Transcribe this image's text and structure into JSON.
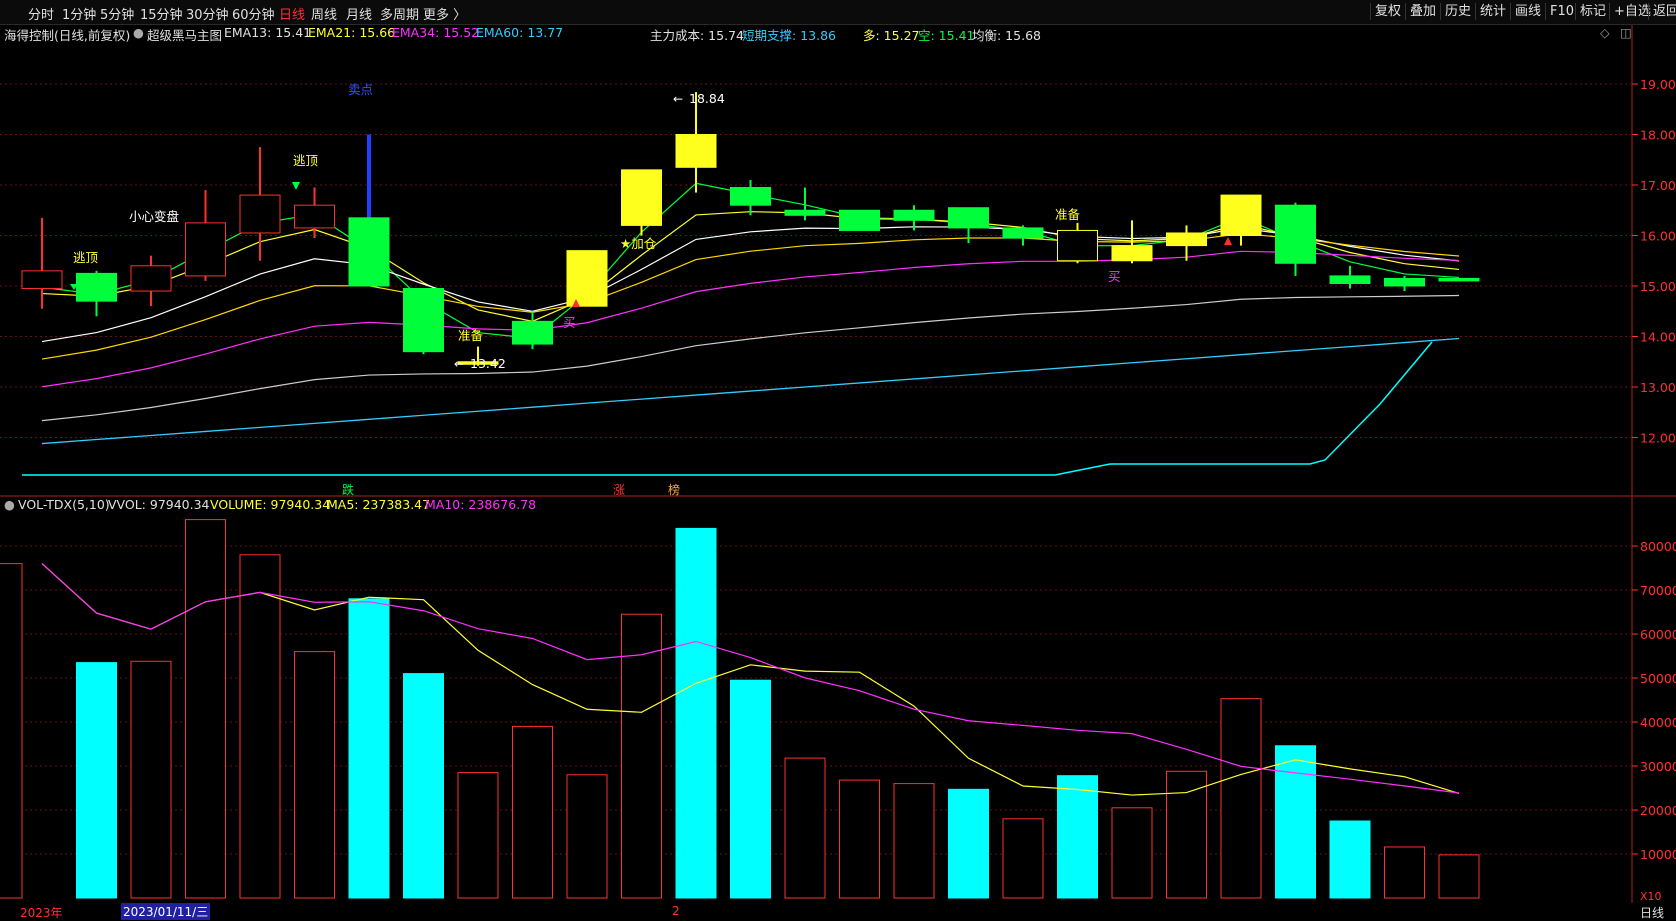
{
  "toolbar": {
    "timeframes": [
      "分时",
      "1分钟",
      "5分钟",
      "15分钟",
      "30分钟",
      "60分钟",
      "日线",
      "周线",
      "月线",
      "多周期",
      "更多 〉"
    ],
    "active_timeframe": "日线",
    "right_buttons": [
      "复权",
      "叠加",
      "历史",
      "统计",
      "画线",
      "F10",
      "标记",
      "+自选",
      "返回"
    ]
  },
  "main_header": {
    "stock": "海得控制(日线,前复权)",
    "indicator": "超级黑马主图",
    "ema13": "EMA13: 15.41",
    "ema21": "EMA21: 15.66",
    "ema34": "EMA34: 15.52",
    "ema60": "EMA60: 13.77",
    "cost": "主力成本: 15.74",
    "support": "短期支撑: 13.86",
    "long": "多: 15.27",
    "short": "空: 15.41",
    "balance": "均衡: 15.68"
  },
  "volume_header": {
    "name": "VOL-TDX(5,10)",
    "vvol": "VVOL: 97940.34",
    "volume": "VOLUME: 97940.34",
    "ma5": "MA5: 237383.47",
    "ma10": "MA10: 238676.78"
  },
  "price_axis": [
    "19.00",
    "18.00",
    "17.00",
    "16.00",
    "15.00",
    "14.00",
    "13.00",
    "12.00"
  ],
  "volume_axis": [
    "80000",
    "70000",
    "60000",
    "50000",
    "40000",
    "30000",
    "20000",
    "10000"
  ],
  "volume_unit": "X10",
  "annotations": {
    "high": "18.84",
    "low": "13.42",
    "sell_point": "卖点",
    "escape1": "逃顶",
    "escape2": "逃顶",
    "caution": "小心变盘",
    "prepare1": "准备",
    "prepare2": "准备",
    "add_position": "★加仓",
    "buy1": "买",
    "buy2": "买",
    "fall_tag": "跌",
    "rise_tag": "涨",
    "list_tag": "榜"
  },
  "bottom_bar": {
    "year": "2023年",
    "date": "2023/01/11/三",
    "marker": "2",
    "period": "日线"
  },
  "candles": [
    {
      "o": 15.3,
      "c": 14.95,
      "h": 16.35,
      "l": 14.55,
      "t": "hollow"
    },
    {
      "o": 15.25,
      "c": 14.7,
      "h": 15.3,
      "l": 14.4,
      "t": "green"
    },
    {
      "o": 14.9,
      "c": 15.4,
      "h": 15.6,
      "l": 14.6,
      "t": "hollow"
    },
    {
      "o": 15.2,
      "c": 16.25,
      "h": 16.9,
      "l": 15.1,
      "t": "hollow"
    },
    {
      "o": 16.05,
      "c": 16.8,
      "h": 17.75,
      "l": 15.5,
      "t": "hollow"
    },
    {
      "o": 16.15,
      "c": 16.6,
      "h": 16.95,
      "l": 15.95,
      "t": "hollow"
    },
    {
      "o": 16.35,
      "c": 15.0,
      "h": 18.0,
      "l": 15.0,
      "t": "green"
    },
    {
      "o": 14.95,
      "c": 13.7,
      "h": 14.95,
      "l": 13.65,
      "t": "green"
    },
    {
      "o": 13.5,
      "c": 13.45,
      "h": 13.8,
      "l": 13.42,
      "t": "yellow"
    },
    {
      "o": 14.3,
      "c": 13.85,
      "h": 14.5,
      "l": 13.75,
      "t": "green"
    },
    {
      "o": 14.6,
      "c": 15.7,
      "h": 15.7,
      "l": 14.6,
      "t": "yellow"
    },
    {
      "o": 16.2,
      "c": 17.3,
      "h": 17.3,
      "l": 16.0,
      "t": "yellow"
    },
    {
      "o": 17.35,
      "c": 18.0,
      "h": 18.84,
      "l": 16.85,
      "t": "yellow"
    },
    {
      "o": 16.95,
      "c": 16.6,
      "h": 17.1,
      "l": 16.4,
      "t": "green"
    },
    {
      "o": 16.5,
      "c": 16.4,
      "h": 16.95,
      "l": 16.3,
      "t": "green"
    },
    {
      "o": 16.5,
      "c": 16.1,
      "h": 16.5,
      "l": 16.1,
      "t": "green"
    },
    {
      "o": 16.5,
      "c": 16.3,
      "h": 16.6,
      "l": 16.1,
      "t": "green"
    },
    {
      "o": 16.55,
      "c": 16.15,
      "h": 16.55,
      "l": 15.85,
      "t": "green"
    },
    {
      "o": 16.15,
      "c": 15.95,
      "h": 16.2,
      "l": 15.8,
      "t": "green"
    },
    {
      "o": 16.1,
      "c": 15.5,
      "h": 16.25,
      "l": 15.45,
      "t": "hollowy"
    },
    {
      "o": 15.5,
      "c": 15.8,
      "h": 16.3,
      "l": 15.45,
      "t": "yellow"
    },
    {
      "o": 15.8,
      "c": 16.05,
      "h": 16.2,
      "l": 15.5,
      "t": "yellow"
    },
    {
      "o": 16.0,
      "c": 16.8,
      "h": 16.8,
      "l": 15.8,
      "t": "yellow"
    },
    {
      "o": 16.6,
      "c": 15.45,
      "h": 16.65,
      "l": 15.2,
      "t": "green"
    },
    {
      "o": 15.2,
      "c": 15.05,
      "h": 15.4,
      "l": 14.95,
      "t": "green"
    },
    {
      "o": 15.15,
      "c": 15.0,
      "h": 15.2,
      "l": 14.9,
      "t": "green"
    },
    {
      "o": 15.15,
      "c": 15.1,
      "h": 15.15,
      "l": 15.1,
      "t": "green"
    }
  ],
  "volumes": [
    {
      "v": 76000,
      "t": "hollow"
    },
    {
      "v": 53500,
      "t": "cyan"
    },
    {
      "v": 53800,
      "t": "hollow"
    },
    {
      "v": 86000,
      "t": "hollow"
    },
    {
      "v": 78000,
      "t": "hollow"
    },
    {
      "v": 56000,
      "t": "hollow"
    },
    {
      "v": 68000,
      "t": "cyan"
    },
    {
      "v": 51000,
      "t": "cyan"
    },
    {
      "v": 28500,
      "t": "hollow"
    },
    {
      "v": 39000,
      "t": "hollow"
    },
    {
      "v": 28000,
      "t": "hollow"
    },
    {
      "v": 64500,
      "t": "hollow"
    },
    {
      "v": 84000,
      "t": "cyan"
    },
    {
      "v": 49500,
      "t": "cyan"
    },
    {
      "v": 31800,
      "t": "hollow"
    },
    {
      "v": 26800,
      "t": "hollow"
    },
    {
      "v": 26000,
      "t": "hollow"
    },
    {
      "v": 24700,
      "t": "cyan"
    },
    {
      "v": 18000,
      "t": "hollow"
    },
    {
      "v": 27800,
      "t": "cyan"
    },
    {
      "v": 20500,
      "t": "hollow"
    },
    {
      "v": 28800,
      "t": "hollow"
    },
    {
      "v": 45300,
      "t": "hollow"
    },
    {
      "v": 34600,
      "t": "cyan"
    },
    {
      "v": 17500,
      "t": "cyan"
    },
    {
      "v": 11600,
      "t": "hollow"
    },
    {
      "v": 9800,
      "t": "hollow"
    }
  ],
  "colors": {
    "up": "#ff3030",
    "down": "#00ff3a",
    "yellow": "#ffff1e",
    "cyan": "#00ffff",
    "ema13": "#ffff30",
    "ema21": "#ffd700",
    "ema34": "#ff30ff",
    "ema60": "#33ccff",
    "grid": "#6a1010"
  }
}
